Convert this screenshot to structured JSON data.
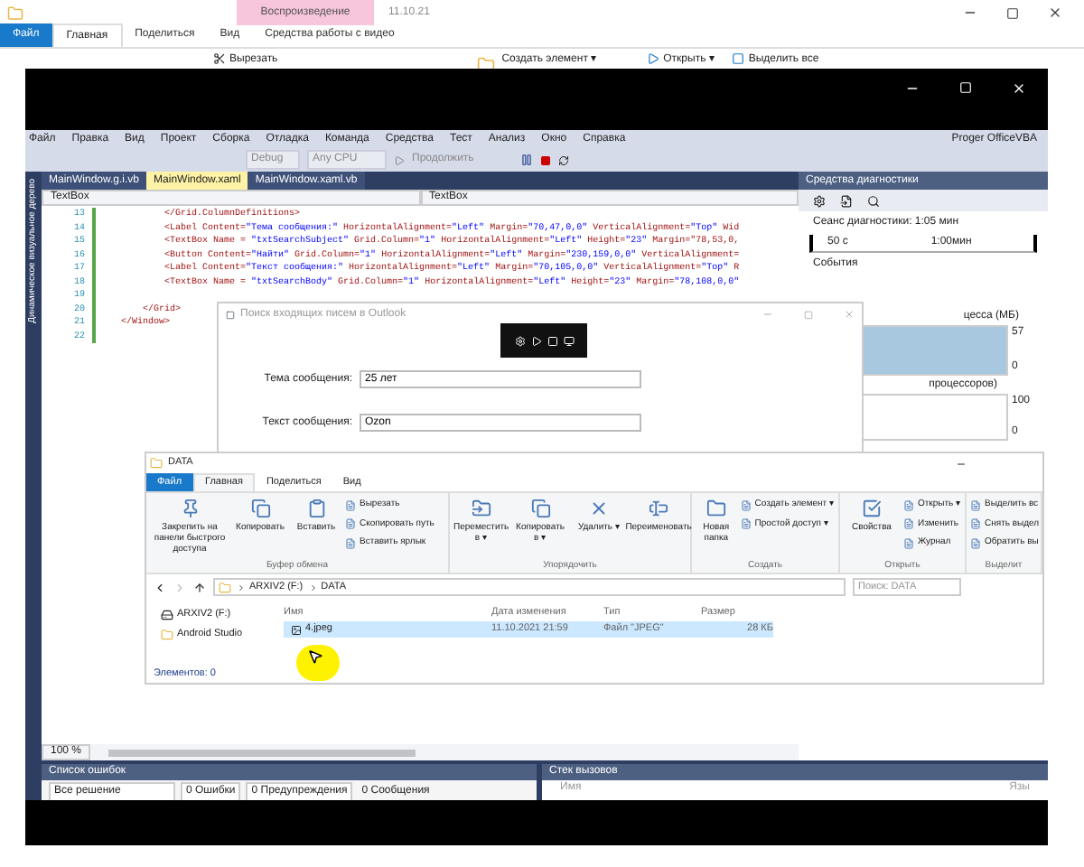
{
  "background_explorer": {
    "context_tab": "Воспроизведение",
    "title": "11.10.21",
    "tabs": [
      {
        "label": "Файл",
        "selected": false,
        "kind": "file"
      },
      {
        "label": "Главная",
        "selected": true,
        "kind": "tab"
      },
      {
        "label": "Поделиться",
        "selected": false,
        "kind": "tab"
      },
      {
        "label": "Вид",
        "selected": false,
        "kind": "tab"
      },
      {
        "label": "Средства работы с видео",
        "selected": false,
        "kind": "tab"
      }
    ],
    "ribbon": [
      "Вырезать",
      "Создать элемент ▾",
      "Открыть ▾",
      "Выделить все"
    ]
  },
  "vs": {
    "menu": [
      "Файл",
      "Правка",
      "Вид",
      "Проект",
      "Сборка",
      "Отладка",
      "Команда",
      "Средства",
      "Тест",
      "Анализ",
      "Окно",
      "Справка"
    ],
    "account": "Proger OfficeVBA",
    "toolbar": {
      "config": "Debug",
      "platform": "Any CPU",
      "continue": "Продолжить"
    },
    "side_tab": "Динамическое визуальное дерево",
    "tabs": [
      {
        "label": "MainWindow.g.i.vb",
        "selected": false
      },
      {
        "label": "MainWindow.xaml",
        "selected": true
      },
      {
        "label": "MainWindow.xaml.vb",
        "selected": false
      }
    ],
    "nav": [
      "TextBox",
      "TextBox"
    ],
    "code": [
      {
        "n": "13",
        "text": "        </Grid.ColumnDefinitions>"
      },
      {
        "n": "14",
        "text": "        <Label Content=\"Тема сообщения:\" HorizontalAlignment=\"Left\" Margin=\"70,47,0,0\" VerticalAlignment=\"Top\" Wid"
      },
      {
        "n": "15",
        "text": "        <TextBox Name = \"txtSearchSubject\" Grid.Column=\"1\" HorizontalAlignment=\"Left\" Height=\"23\" Margin=\"78,53,0,"
      },
      {
        "n": "16",
        "text": "        <Button Content=\"Найти\" Grid.Column=\"1\" HorizontalAlignment=\"Left\" Margin=\"230,159,0,0\" VerticalAlignment="
      },
      {
        "n": "17",
        "text": "        <Label Content=\"Текст сообщения:\" HorizontalAlignment=\"Left\" Margin=\"70,105,0,0\" VerticalAlignment=\"Top\" R"
      },
      {
        "n": "18",
        "text": "        <TextBox Name = \"txtSearchBody\" Grid.Column=\"1\" HorizontalAlignment=\"Left\" Height=\"23\" Margin=\"78,108,0,0\""
      },
      {
        "n": "19"
      },
      {
        "n": "20",
        "text": "    </Grid>"
      },
      {
        "n": "21",
        "text": "</Window>"
      },
      {
        "n": "22"
      }
    ],
    "zoom": "100 %",
    "diagnostics": {
      "title": "Средства диагностики",
      "session": "Сеанс диагностики: 1:05 мин",
      "ticks": [
        "50 с",
        "1:00мин"
      ],
      "events": "События",
      "memory": "цесса (МБ)",
      "memory_max": "57",
      "memory_min": "0",
      "cpu": "процессоров)",
      "cpu_max": "100",
      "cpu_min": "0"
    },
    "error_list": {
      "title": "Список ошибок",
      "scope": "Все решение",
      "errors": "0 Ошибки",
      "warnings": "0 Предупреждения",
      "messages": "0 Сообщения"
    },
    "call_stack": {
      "title": "Стек вызовов",
      "columns": [
        "Имя",
        "Язы"
      ]
    }
  },
  "outlook_dialog": {
    "title": "Поиск входящих писем в Outlook",
    "fields": [
      {
        "label": "Тема сообщения:",
        "value": "25 лет"
      },
      {
        "label": "Текст сообщения:",
        "value": "Ozon"
      }
    ]
  },
  "explorer": {
    "title": "DATA",
    "tabs": [
      {
        "label": "Файл",
        "selected": false,
        "kind": "file"
      },
      {
        "label": "Главная",
        "selected": true,
        "kind": "tab"
      },
      {
        "label": "Поделиться",
        "selected": false,
        "kind": "tab"
      },
      {
        "label": "Вид",
        "selected": false,
        "kind": "tab"
      }
    ],
    "groups": [
      {
        "label": "Буфер обмена",
        "large": [
          "Закрепить на панели быстрого доступа",
          "Копировать",
          "Вставить"
        ],
        "small": [
          "Вырезать",
          "Скопировать путь",
          "Вставить ярлык"
        ]
      },
      {
        "label": "Упорядочить",
        "large": [
          "Переместить в ▾",
          "Копировать в ▾",
          "Удалить ▾",
          "Переименовать"
        ]
      },
      {
        "label": "Создать",
        "large": [
          "Новая папка"
        ],
        "small": [
          "Создать элемент ▾",
          "Простой доступ ▾"
        ]
      },
      {
        "label": "Открыть",
        "large": [
          "Свойства"
        ],
        "small": [
          "Открыть ▾",
          "Изменить",
          "Журнал"
        ]
      },
      {
        "label": "Выделит",
        "small": [
          "Выделить вс",
          "Снять выдел",
          "Обратить вы"
        ]
      }
    ],
    "path": [
      "ARXIV2 (F:)",
      "DATA"
    ],
    "search_placeholder": "Поиск: DATA",
    "tree": [
      {
        "label": "ARXIV2 (F:)",
        "kind": "drive"
      },
      {
        "label": "Android Studio",
        "kind": "folder"
      }
    ],
    "columns": [
      "Имя",
      "Дата изменения",
      "Тип",
      "Размер"
    ],
    "rows": [
      {
        "name": "4.jpeg",
        "date": "11.10.2021 21:59",
        "type": "Файл \"JPEG\"",
        "size": "28 КБ",
        "selected": true
      }
    ],
    "status": "Элементов: 0"
  }
}
